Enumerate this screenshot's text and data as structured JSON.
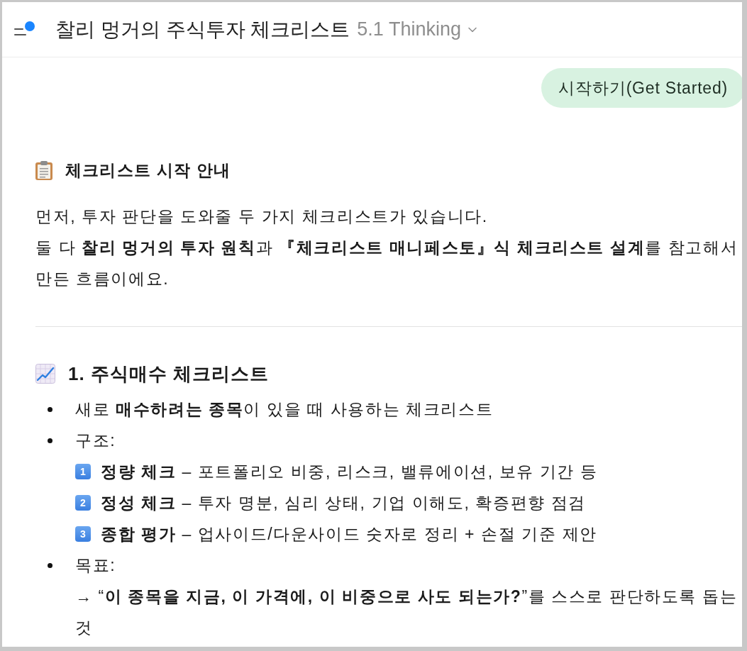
{
  "header": {
    "title": "찰리 멍거의 주식투자 체크리스트",
    "model": "5.1 Thinking"
  },
  "user_message": {
    "text": "시작하기(Get Started)"
  },
  "intro": {
    "heading": "체크리스트 시작 안내",
    "lines": [
      "먼저, 투자 판단을 도와줄 두 가지 체크리스트가 있습니다.",
      "둘 다 **찰리 멍거의 투자 원칙**과 **『체크리스트 매니페스토』식 체크리스트 설계**를 참고해서 만든 흐름이에요."
    ]
  },
  "section": {
    "heading": "1. 주식매수 체크리스트",
    "bullets": [
      {
        "text": "새로 **매수하려는 종목**이 있을 때 사용하는 체크리스트"
      },
      {
        "text": "구조:",
        "children": [
          {
            "kind": "numbered",
            "number": "1",
            "text": "**정량 체크** – 포트폴리오 비중, 리스크, 밸류에이션, 보유 기간 등"
          },
          {
            "kind": "numbered",
            "number": "2",
            "text": "**정성 체크** – 투자 명분, 심리 상태, 기업 이해도, 확증편향 점검"
          },
          {
            "kind": "numbered",
            "number": "3",
            "text": "**종합 평가** – 업사이드/다운사이드 숫자로 정리 + 손절 기준 제안"
          }
        ]
      },
      {
        "text": "목표:",
        "children": [
          {
            "kind": "plain",
            "text": "→ “**이 종목을 지금, 이 가격에, 이 비중으로 사도 되는가?**”를 스스로 판단하도록 돕는 것"
          }
        ]
      }
    ]
  }
}
